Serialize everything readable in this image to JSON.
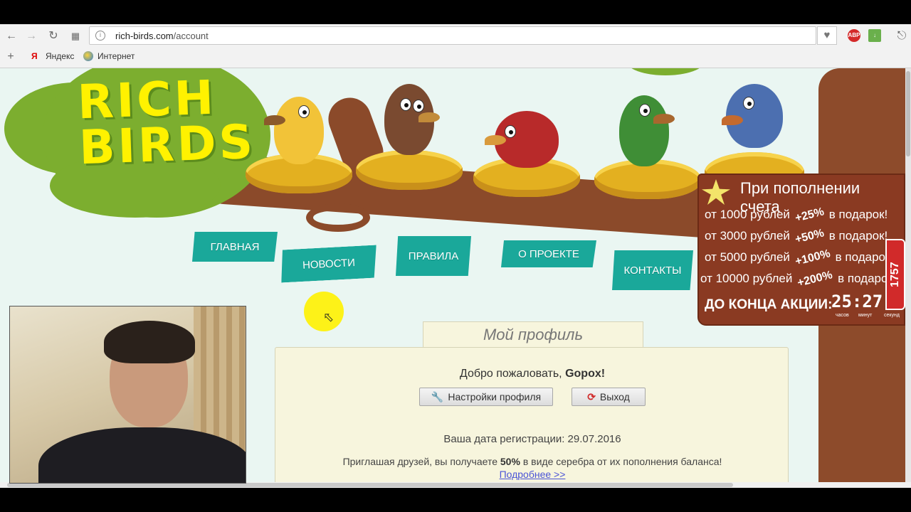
{
  "browser": {
    "url_host": "rich-birds.com",
    "url_path": "/account",
    "bookmarks": [
      {
        "label": "Яндекс",
        "icon": "yandex-icon"
      },
      {
        "label": "Интернет",
        "icon": "globe-icon"
      }
    ],
    "extensions": [
      {
        "label": "ABP",
        "icon": "adblock-icon",
        "color": "#d42a2a"
      },
      {
        "label": "",
        "icon": "download-arrow-icon",
        "color": "#6ab04c"
      }
    ]
  },
  "site": {
    "logo_line1": "RICH",
    "logo_line2": "BIRDS",
    "menu": [
      {
        "label": "ГЛАВНАЯ"
      },
      {
        "label": "НОВОСТИ"
      },
      {
        "label": "ПРАВИЛА"
      },
      {
        "label": "О ПРОЕКТЕ"
      },
      {
        "label": "КОНТАКТЫ"
      }
    ]
  },
  "promo": {
    "title": "При пополнении счета",
    "rows": [
      {
        "from": "от 1000 рублей",
        "bonus": "+25%",
        "suffix": "в подарок!"
      },
      {
        "from": "от 3000 рублей",
        "bonus": "+50%",
        "suffix": "в подарок!"
      },
      {
        "from": "от 5000 рублей",
        "bonus": "+100%",
        "suffix": "в подарок!"
      },
      {
        "from": "от 10000 рублей",
        "bonus": "+200%",
        "suffix": "в подарок!"
      }
    ],
    "timer_label": "ДО КОНЦА АКЦИИ:",
    "timer_value": "25:27:",
    "timer_units": [
      "часов",
      "минут",
      "секунд"
    ],
    "side_badge": "1757"
  },
  "profile": {
    "tab_title": "Мой профиль",
    "welcome_text": "Добро пожаловать,",
    "username": "Gopox!",
    "settings_button": "Настройки профиля",
    "logout_button": "Выход",
    "registration": "Ваша дата регистрации: 29.07.2016",
    "invite_before": "Приглашая друзей, вы получаете",
    "invite_percent": "50%",
    "invite_after": "в виде серебра от их пополнения баланса!",
    "more_link": "Подробнее >>"
  },
  "colors": {
    "menu_teal": "#1aa89a",
    "logo_yellow": "#fff200",
    "promo_brown": "#8a3a22",
    "panel_cream": "#f7f5dd"
  }
}
